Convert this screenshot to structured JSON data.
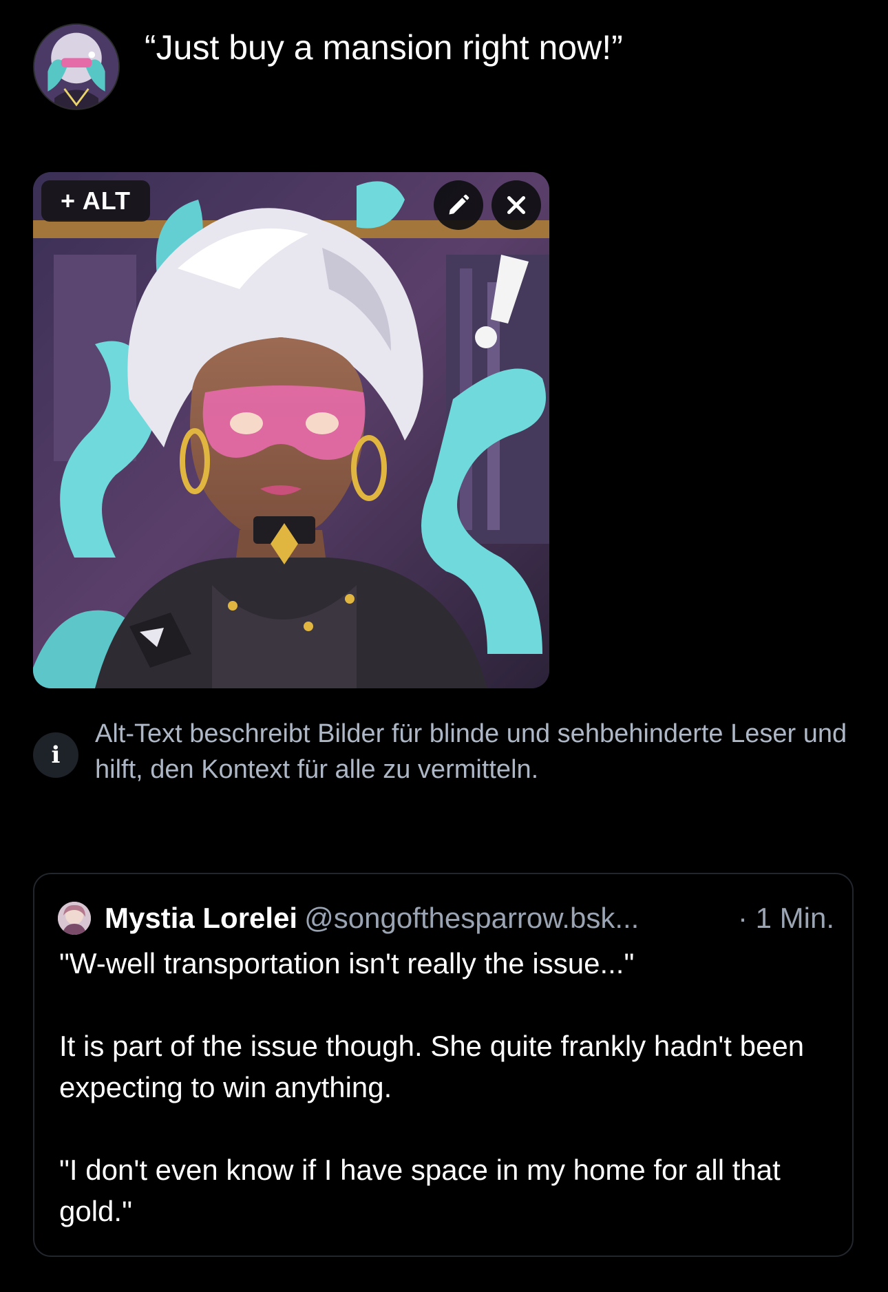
{
  "composer": {
    "avatar_icon": "user-avatar",
    "text": "“Just buy a mansion right now!”"
  },
  "attachment": {
    "alt_button_label": "+ ALT",
    "edit_icon": "pencil-icon",
    "close_icon": "close-icon"
  },
  "alt_hint": {
    "icon": "i",
    "text": "Alt-Text beschreibt Bilder für blinde und sehbehinderte Leser und hilft, den Kontext für alle zu vermitteln."
  },
  "quoted_post": {
    "author_name": "Mystia Lorelei",
    "author_handle": "@songofthesparrow.bsk...",
    "time": "· 1 Min.",
    "paragraphs": [
      "\"W-well transportation isn't really the issue...\"",
      "It is part of the issue though.  She quite frankly hadn't been expecting to win anything.",
      "\"I don't even know if I have space in my home for all that gold.\""
    ]
  },
  "colors": {
    "background": "#000000",
    "text_primary": "#ffffff",
    "text_secondary": "#9aa4b3",
    "card_border": "#22262d",
    "accent_teal": "#6fd9db",
    "accent_pink": "#e46aa8"
  }
}
